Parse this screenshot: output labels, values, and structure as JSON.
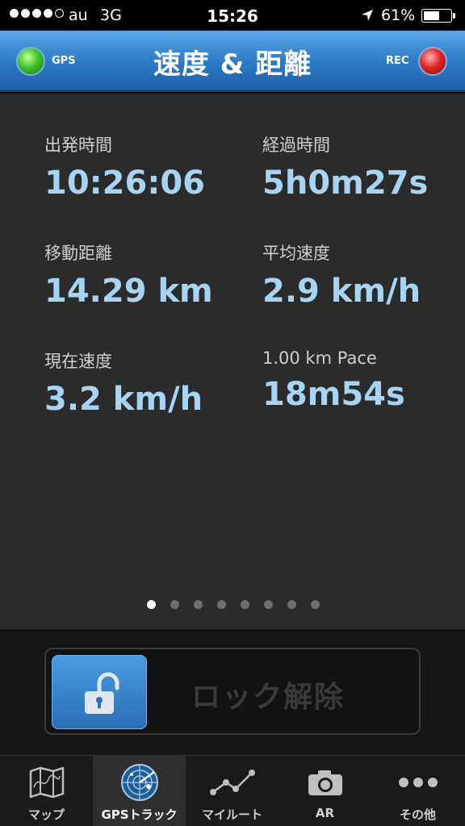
{
  "status_bar": {
    "carrier": "au",
    "network": "3G",
    "time": "15:26",
    "battery": "61%",
    "battery_level": 0.61
  },
  "nav": {
    "gps_label": "GPS",
    "title": "速度 & 距離",
    "rec_label": "REC",
    "gps_led_color": "#3fc52a",
    "rec_led_color": "#e52222"
  },
  "stats": {
    "start_time": {
      "label": "出発時間",
      "value": "10:26:06"
    },
    "elapsed_time": {
      "label": "経過時間",
      "value": "5h0m27s"
    },
    "distance": {
      "label": "移動距離",
      "value": "14.29 km"
    },
    "avg_speed": {
      "label": "平均速度",
      "value": "2.9 km/h"
    },
    "current_speed": {
      "label": "現在速度",
      "value": "3.2 km/h"
    },
    "pace": {
      "label": "1.00 km Pace",
      "value": "18m54s"
    }
  },
  "pager": {
    "count": 8,
    "active": 1
  },
  "lock": {
    "label": "ロック解除"
  },
  "tabs": [
    {
      "label": "マップ",
      "icon": "map-icon"
    },
    {
      "label": "GPSトラック",
      "icon": "radar-icon"
    },
    {
      "label": "マイルート",
      "icon": "route-icon"
    },
    {
      "label": "AR",
      "icon": "camera-icon"
    },
    {
      "label": "その他",
      "icon": "more-icon"
    }
  ],
  "active_tab": 2,
  "colors": {
    "accent": "#2c78c4",
    "value_text": "#a7d4f2"
  }
}
